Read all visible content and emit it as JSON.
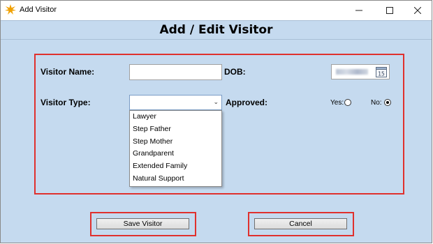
{
  "window": {
    "title": "Add Visitor",
    "icon": "star-burst-icon",
    "controls": {
      "minimize": "minimize-icon",
      "maximize": "maximize-icon",
      "close": "close-icon"
    }
  },
  "header": {
    "title": "Add / Edit Visitor"
  },
  "form": {
    "visitor_name_label": "Visitor Name:",
    "visitor_name_value": "",
    "dob_label": "DOB:",
    "dob_icon": "calendar-icon",
    "dob_icon_text": "15",
    "visitor_type_label": "Visitor Type:",
    "visitor_type_value": "",
    "visitor_type_options": [
      "Lawyer",
      "Step Father",
      "Step Mother",
      "Grandparent",
      "Extended Family",
      "Natural Support"
    ],
    "approved_label": "Approved:",
    "yes_label": "Yes:",
    "no_label": "No:",
    "approved_value": "No"
  },
  "buttons": {
    "save": "Save Visitor",
    "cancel": "Cancel"
  },
  "colors": {
    "background": "#c5daef",
    "highlight_border": "#e0302d"
  }
}
